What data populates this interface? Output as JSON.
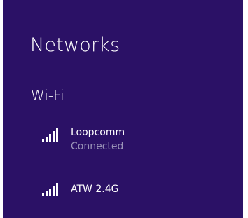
{
  "panel": {
    "title": "Networks",
    "section_title": "Wi-Fi"
  },
  "networks": [
    {
      "name": "Loopcomm",
      "status": "Connected",
      "icon": "wifi-signal-icon"
    },
    {
      "name": "ATW 2.4G",
      "icon": "wifi-signal-icon"
    }
  ],
  "colors": {
    "background": "#2b1166",
    "text": "#ffffff",
    "status_text": "#9a93b8"
  }
}
